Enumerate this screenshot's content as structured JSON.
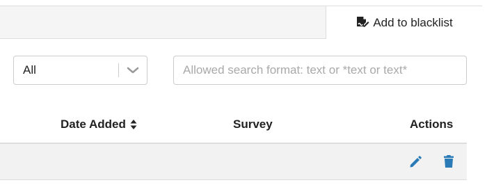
{
  "toolbar": {
    "add_blacklist_label": "Add to blacklist",
    "add_blacklist_icon": "file-signature-icon"
  },
  "filters": {
    "select_value": "All",
    "search_placeholder": "Allowed search format: text or *text or text*",
    "search_value": ""
  },
  "table": {
    "columns": [
      {
        "label": "Date Added",
        "sortable": true
      },
      {
        "label": "Survey",
        "sortable": false
      },
      {
        "label": "Actions",
        "sortable": false
      }
    ],
    "rows": [
      {
        "actions": [
          "pencil-icon",
          "trash-icon"
        ]
      }
    ]
  },
  "colors": {
    "action_blue": "#2a7ab8",
    "header_bg": "#f5f5f5",
    "row_bg": "#f2f2f2",
    "border": "#dddddd"
  }
}
